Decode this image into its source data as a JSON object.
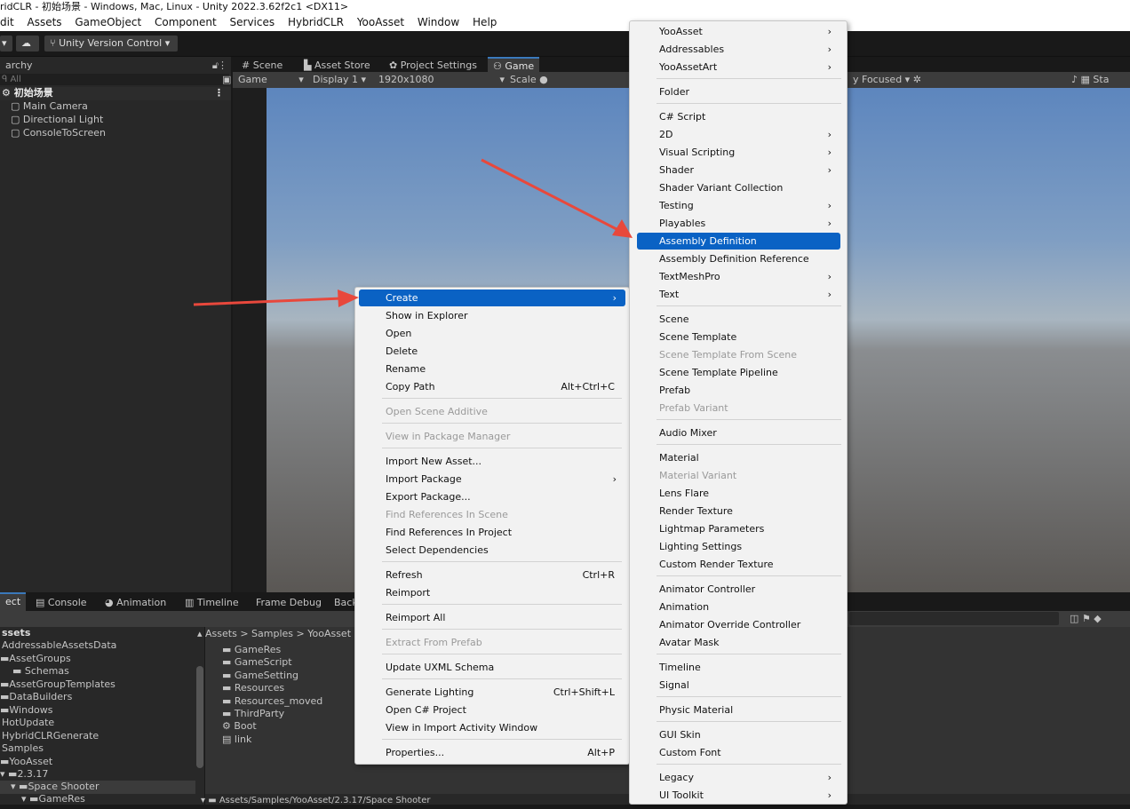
{
  "title": "ridCLR - 初始场景 - Windows, Mac, Linux - Unity 2022.3.62f2c1 <DX11>",
  "menu": [
    "dit",
    "Assets",
    "GameObject",
    "Component",
    "Services",
    "HybridCLR",
    "YooAsset",
    "Window",
    "Help"
  ],
  "toolbar": {
    "uvc": "Unity Version Control"
  },
  "hierarchy": {
    "tab": "archy",
    "search": "All",
    "scene": "初始场景",
    "items": [
      "Main Camera",
      "Directional Light",
      "ConsoleToScreen"
    ]
  },
  "scene_tabs": [
    "Scene",
    "Asset Store",
    "Project Settings",
    "Game"
  ],
  "game_bar": {
    "mode": "Game",
    "display": "Display 1",
    "res": "1920x1080",
    "scale": "Scale",
    "focus": "y Focused",
    "stats": "Sta"
  },
  "bottom_tabs": [
    "ect",
    "Console",
    "Animation",
    "Timeline",
    "Frame Debug",
    "Back"
  ],
  "project_tree": [
    "ssets",
    "AddressableAssetsData",
    "AssetGroups",
    "Schemas",
    "AssetGroupTemplates",
    "DataBuilders",
    "Windows",
    "HotUpdate",
    "HybridCLRGenerate",
    "Samples",
    "YooAsset",
    "2.3.17",
    "Space Shooter",
    "GameRes"
  ],
  "breadcrumb": "Assets > Samples > YooAsset",
  "project_files": [
    "GameRes",
    "GameScript",
    "GameSetting",
    "Resources",
    "Resources_moved",
    "ThirdParty",
    "Boot",
    "link"
  ],
  "footer_path": "Assets/Samples/YooAsset/2.3.17/Space Shooter",
  "context_menu": [
    {
      "label": "Create",
      "sel": true,
      "sub": true
    },
    {
      "label": "Show in Explorer"
    },
    {
      "label": "Open"
    },
    {
      "label": "Delete"
    },
    {
      "label": "Rename"
    },
    {
      "label": "Copy Path",
      "sc": "Alt+Ctrl+C"
    },
    {
      "label": "Open Scene Additive",
      "dis": true
    },
    {
      "label": "View in Package Manager",
      "dis": true
    },
    {
      "label": "Import New Asset..."
    },
    {
      "label": "Import Package",
      "sub": true
    },
    {
      "label": "Export Package..."
    },
    {
      "label": "Find References In Scene",
      "dis": true
    },
    {
      "label": "Find References In Project"
    },
    {
      "label": "Select Dependencies"
    },
    {
      "label": "Refresh",
      "sc": "Ctrl+R"
    },
    {
      "label": "Reimport"
    },
    {
      "label": "Reimport All"
    },
    {
      "label": "Extract From Prefab",
      "dis": true
    },
    {
      "label": "Update UXML Schema"
    },
    {
      "label": "Generate Lighting",
      "sc": "Ctrl+Shift+L"
    },
    {
      "label": "Open C# Project"
    },
    {
      "label": "View in Import Activity Window"
    },
    {
      "label": "Properties...",
      "sc": "Alt+P"
    }
  ],
  "create_menu": [
    {
      "label": "YooAsset",
      "sub": true
    },
    {
      "label": "Addressables",
      "sub": true
    },
    {
      "label": "YooAssetArt",
      "sub": true
    },
    {
      "label": "Folder"
    },
    {
      "label": "C# Script"
    },
    {
      "label": "2D",
      "sub": true
    },
    {
      "label": "Visual Scripting",
      "sub": true
    },
    {
      "label": "Shader",
      "sub": true
    },
    {
      "label": "Shader Variant Collection"
    },
    {
      "label": "Testing",
      "sub": true
    },
    {
      "label": "Playables",
      "sub": true
    },
    {
      "label": "Assembly Definition",
      "sel": true
    },
    {
      "label": "Assembly Definition Reference"
    },
    {
      "label": "TextMeshPro",
      "sub": true
    },
    {
      "label": "Text",
      "sub": true
    },
    {
      "label": "Scene"
    },
    {
      "label": "Scene Template"
    },
    {
      "label": "Scene Template From Scene",
      "dis": true
    },
    {
      "label": "Scene Template Pipeline"
    },
    {
      "label": "Prefab"
    },
    {
      "label": "Prefab Variant",
      "dis": true
    },
    {
      "label": "Audio Mixer"
    },
    {
      "label": "Material"
    },
    {
      "label": "Material Variant",
      "dis": true
    },
    {
      "label": "Lens Flare"
    },
    {
      "label": "Render Texture"
    },
    {
      "label": "Lightmap Parameters"
    },
    {
      "label": "Lighting Settings"
    },
    {
      "label": "Custom Render Texture"
    },
    {
      "label": "Animator Controller"
    },
    {
      "label": "Animation"
    },
    {
      "label": "Animator Override Controller"
    },
    {
      "label": "Avatar Mask"
    },
    {
      "label": "Timeline"
    },
    {
      "label": "Signal"
    },
    {
      "label": "Physic Material"
    },
    {
      "label": "GUI Skin"
    },
    {
      "label": "Custom Font"
    },
    {
      "label": "Legacy",
      "sub": true
    },
    {
      "label": "UI Toolkit",
      "sub": true
    }
  ],
  "colors": {
    "accent": "#0a62c4",
    "arrow": "#e8483c"
  }
}
